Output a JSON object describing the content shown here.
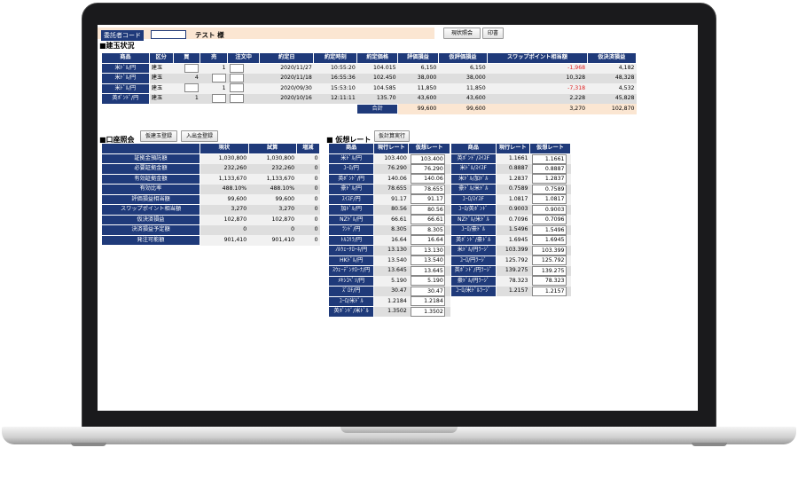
{
  "header": {
    "label": "委託者コード",
    "name": "テスト 様",
    "btn_status": "現状照会",
    "btn_print": "印書"
  },
  "positions": {
    "title": "■建玉状況",
    "columns": [
      "商品",
      "区分",
      "買",
      "売",
      "注文中",
      "約定日",
      "約定時刻",
      "約定価格",
      "評価損益",
      "仮評価損益",
      "スワップポイント相当額",
      "仮決済損益"
    ],
    "rows": [
      {
        "product": "米ﾄﾞﾙ/円",
        "kind": "建玉",
        "buy": "",
        "sell": "1",
        "order": "",
        "date": "2020/11/27",
        "time": "10:55:20",
        "price": "104.015",
        "pl": "6,150",
        "vpl": "6,150",
        "swap": "-1,968",
        "swap_neg": true,
        "close": "4,182"
      },
      {
        "product": "米ﾄﾞﾙ/円",
        "kind": "建玉",
        "buy": "4",
        "sell": "",
        "order": "",
        "date": "2020/11/18",
        "time": "16:55:36",
        "price": "102.450",
        "pl": "38,000",
        "vpl": "38,000",
        "swap": "10,328",
        "swap_neg": false,
        "close": "48,328"
      },
      {
        "product": "米ﾄﾞﾙ/円",
        "kind": "建玉",
        "buy": "",
        "sell": "1",
        "order": "",
        "date": "2020/09/30",
        "time": "15:53:10",
        "price": "104.585",
        "pl": "11,850",
        "vpl": "11,850",
        "swap": "-7,318",
        "swap_neg": true,
        "close": "4,532"
      },
      {
        "product": "英ﾎﾟﾝﾄﾞ/円",
        "kind": "建玉",
        "buy": "1",
        "sell": "",
        "order": "",
        "date": "2020/10/16",
        "time": "12:11:11",
        "price": "135.70",
        "pl": "43,600",
        "vpl": "43,600",
        "swap": "2,228",
        "swap_neg": false,
        "close": "45,828"
      }
    ],
    "total_label": "合計",
    "total": {
      "pl": "99,600",
      "vpl": "99,600",
      "swap": "3,270",
      "close": "102,870"
    }
  },
  "account": {
    "title": "■口座照会",
    "btn1": "仮建玉登録",
    "btn2": "入出金登録",
    "columns": [
      "",
      "現状",
      "試算",
      "増減"
    ],
    "rows": [
      [
        "証拠金預託額",
        "1,030,800",
        "1,030,800",
        "0"
      ],
      [
        "必要証拠金額",
        "232,260",
        "232,260",
        "0"
      ],
      [
        "有効証拠金額",
        "1,133,670",
        "1,133,670",
        "0"
      ],
      [
        "有効比率",
        "488.10%",
        "488.10%",
        "0"
      ],
      [
        "評価損益相当額",
        "99,600",
        "99,600",
        "0"
      ],
      [
        "スワップポイント相当額",
        "3,270",
        "3,270",
        "0"
      ],
      [
        "仮決済損益",
        "102,870",
        "102,870",
        "0"
      ],
      [
        "決済損益予定額",
        "0",
        "0",
        "0"
      ],
      [
        "発注可能額",
        "901,410",
        "901,410",
        "0"
      ]
    ]
  },
  "rates": {
    "title": "■ 仮想レート",
    "btn": "仮計算実行",
    "columns": [
      "商品",
      "現行レート",
      "仮想レート"
    ],
    "left": [
      [
        "米ﾄﾞﾙ/円",
        "103.400",
        "103.400"
      ],
      [
        "ﾕｰﾛ/円",
        "76.290",
        "76.290"
      ],
      [
        "英ﾎﾟﾝﾄﾞ/円",
        "140.06",
        "140.06"
      ],
      [
        "豪ﾄﾞﾙ/円",
        "78.655",
        "78.655"
      ],
      [
        "ｽｲｽF/円",
        "91.17",
        "91.17"
      ],
      [
        "加ﾄﾞﾙ/円",
        "80.56",
        "80.56"
      ],
      [
        "NZﾄﾞﾙ/円",
        "66.61",
        "66.61"
      ],
      [
        "ﾗﾝﾄﾞ/円",
        "8.305",
        "8.305"
      ],
      [
        "ﾄﾙｺﾘﾗ/円",
        "16.64",
        "16.64"
      ],
      [
        "ﾉﾙｳｪｰｸﾛｰﾈ/円",
        "13.130",
        "13.130"
      ],
      [
        "HKﾄﾞﾙ/円",
        "13.540",
        "13.540"
      ],
      [
        "ｽｳｪｰﾃﾞﾝｸﾛｰﾅ/円",
        "13.645",
        "13.645"
      ],
      [
        "ﾒｷｼｺﾍﾟｿ/円",
        "5.190",
        "5.190"
      ],
      [
        "ｽﾞﾛﾁ/円",
        "30.47",
        "30.47"
      ],
      [
        "ﾕｰﾛ/米ﾄﾞﾙ",
        "1.2184",
        "1.2184"
      ],
      [
        "英ﾎﾟﾝﾄﾞ/米ﾄﾞﾙ",
        "1.3502",
        "1.3502"
      ]
    ],
    "right": [
      [
        "英ﾎﾟﾝﾄﾞ/ｽｲｽF",
        "1.1661",
        "1.1661"
      ],
      [
        "米ﾄﾞﾙ/ｽｲｽF",
        "0.8887",
        "0.8887"
      ],
      [
        "米ﾄﾞﾙ/加ﾄﾞﾙ",
        "1.2837",
        "1.2837"
      ],
      [
        "豪ﾄﾞﾙ/米ﾄﾞﾙ",
        "0.7589",
        "0.7589"
      ],
      [
        "ﾕｰﾛ/ｽｲｽF",
        "1.0817",
        "1.0817"
      ],
      [
        "ﾕｰﾛ/英ﾎﾟﾝﾄﾞ",
        "0.9003",
        "0.9003"
      ],
      [
        "NZﾄﾞﾙ/米ﾄﾞﾙ",
        "0.7096",
        "0.7096"
      ],
      [
        "ﾕｰﾛ/豪ﾄﾞﾙ",
        "1.5496",
        "1.5496"
      ],
      [
        "英ﾎﾟﾝﾄﾞ/豪ﾄﾞﾙ",
        "1.6945",
        "1.6945"
      ],
      [
        "米ﾄﾞﾙ/円ﾗｰｼﾞ",
        "103.399",
        "103.399"
      ],
      [
        "ﾕｰﾛ/円ﾗｰｼﾞ",
        "125.792",
        "125.792"
      ],
      [
        "英ﾎﾟﾝﾄﾞ/円ﾗｰｼﾞ",
        "139.275",
        "139.275"
      ],
      [
        "豪ﾄﾞﾙ/円ﾗｰｼﾞ",
        "78.323",
        "78.323"
      ],
      [
        "ﾕｰﾛ/米ﾄﾞﾙﾗｰｼﾞ",
        "1.2157",
        "1.2157"
      ]
    ]
  }
}
